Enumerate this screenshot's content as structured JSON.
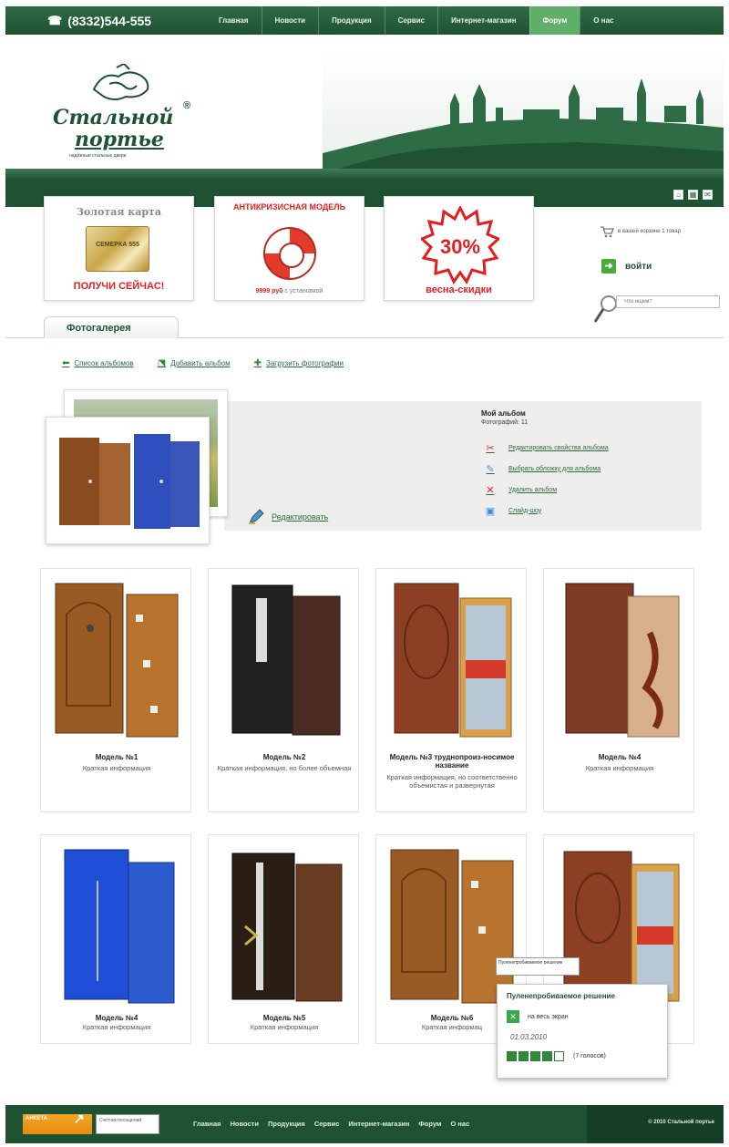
{
  "topnav": {
    "phone": "(8332)544-555",
    "items": [
      "Главная",
      "Новости",
      "Продукция",
      "Сервис",
      "Интернет-магазин",
      "Форум",
      "О нас"
    ],
    "active_index": 5
  },
  "logo": {
    "line1": "Стальной",
    "line2": "портье",
    "registered": "®",
    "tagline": "надёжные стальные двери"
  },
  "promos": {
    "gold": {
      "title": "Золотая карта",
      "card_text": "СЕМЕРКА 555",
      "cta": "ПОЛУЧИ СЕЙЧАС!"
    },
    "antikris": {
      "title": "АНТИКРИЗИСНАЯ МОДЕЛЬ",
      "price_bold": "9999 руб",
      "price_rest": "с установкой"
    },
    "spring": {
      "percent": "30%",
      "cta": "весна-скидки"
    }
  },
  "sidebar": {
    "cart_text": "в вашей корзине 1 товар",
    "login_label": "войти",
    "search_placeholder": "Что ищем?"
  },
  "tab": {
    "label": "Фотогалерея"
  },
  "album_actions": [
    {
      "label": "Список альбомов",
      "icon": "arrow-left-icon"
    },
    {
      "label": "Добавить альбом",
      "icon": "add-album-icon"
    },
    {
      "label": "Загрузить фотографии",
      "icon": "plus-icon"
    }
  ],
  "album": {
    "edit_label": "Редактировать",
    "title": "Мой альбом",
    "count": "Фотографий: 11",
    "links": [
      {
        "label": "Редактировать свойства альбома",
        "icon": "edit-properties-icon"
      },
      {
        "label": "Выбрать обложку для альбома",
        "icon": "choose-cover-icon"
      },
      {
        "label": "Удалить альбом",
        "icon": "delete-icon"
      },
      {
        "label": "Слайд-шоу",
        "icon": "slideshow-icon"
      }
    ]
  },
  "products": [
    {
      "name": "Модель №1",
      "desc": "Краткая информация"
    },
    {
      "name": "Модель №2",
      "desc": "Краткая информация, но более объемная"
    },
    {
      "name": "Модель №3 труднопроиз-носимое название",
      "desc": "Краткая информация, но соответственно объемистая и развернутая"
    },
    {
      "name": "Модель №4",
      "desc": "Краткая информация"
    },
    {
      "name": "Модель №4",
      "desc": "Краткая информация"
    },
    {
      "name": "Модель №5",
      "desc": "Краткая информация"
    },
    {
      "name": "Модель №6",
      "desc": "Краткая информац"
    },
    {
      "name": "",
      "desc": ""
    }
  ],
  "tooltip": {
    "text": "Пуленепробиваемое решение"
  },
  "popup": {
    "title": "Пуленепробиваемое решение",
    "fullscreen": "на весь экран",
    "date": "01.03.2010",
    "rating": 4,
    "rating_max": 5,
    "votes": "(7 голосов)"
  },
  "footer": {
    "badge1": "АНКЕТА",
    "badge2": "Счётчик посещений",
    "nav": [
      "Главная",
      "Новости",
      "Продукция",
      "Сервис",
      "Интернет-магазин",
      "Форум",
      "О нас"
    ],
    "copyright": "© 2010 Стальной портье"
  },
  "colors": {
    "brand_green": "#1f5233",
    "accent_green": "#5fae6a",
    "promo_red": "#e21f1f"
  }
}
